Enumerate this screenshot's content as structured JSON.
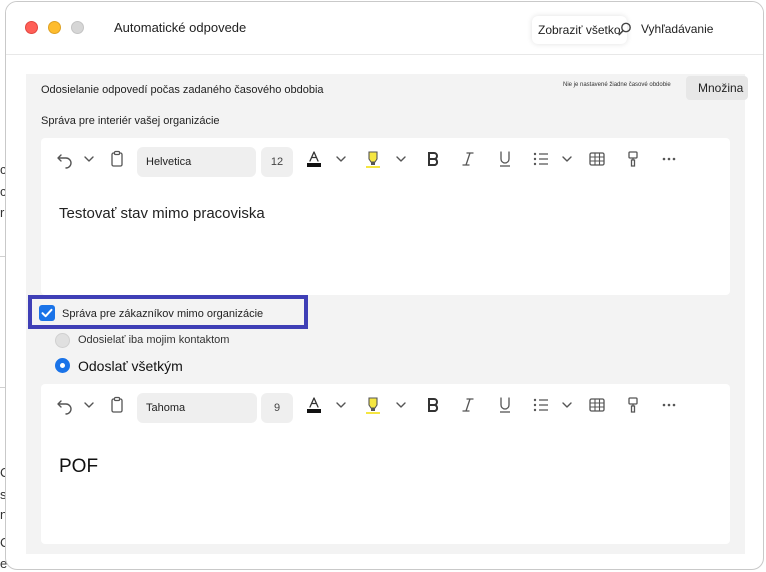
{
  "background_fragments": [
    "c",
    "c",
    "r",
    "C",
    "s",
    "n",
    "C",
    "e",
    "C",
    "s..."
  ],
  "window": {
    "title": "Automatické odpovede",
    "show_all": "Zobraziť všetko",
    "search_label": "Vyhľadávanie"
  },
  "period": {
    "label": "Odosielanie odpovedí počas zadaného časového obdobia",
    "note": "Nie je nastavené žiadne časové obdobie",
    "button": "Množina"
  },
  "internal": {
    "label": "Správa pre interiér vašej organizácie",
    "toolbar": {
      "font": "Helvetica",
      "size": "12"
    },
    "message": "Testovať stav mimo pracoviska"
  },
  "external": {
    "checkbox_label": "Správa pre zákazníkov mimo organizácie",
    "checked": true,
    "option_contacts": "Odosielať iba mojim kontaktom",
    "option_all": "Odoslať všetkým",
    "selected_option": "Odoslať všetkým",
    "toolbar": {
      "font": "Tahoma",
      "size": "9"
    },
    "message": "POF"
  },
  "colors": {
    "highlight_box": "#3f3fb6",
    "checkbox": "#1a73e8",
    "highlighter": "#f5e642"
  }
}
